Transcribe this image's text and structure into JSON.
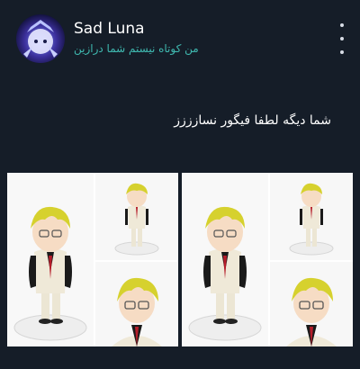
{
  "user": {
    "name": "Sad Luna",
    "handle": "من کوتاه نیستم شما درازین"
  },
  "post": {
    "text": "شما دیگه لطفا فیگور نسازززز"
  },
  "icons": {
    "menu": "more-vertical-icon"
  },
  "colors": {
    "background": "#151d28",
    "handle": "#3fb9b0",
    "text": "#ffffff"
  }
}
